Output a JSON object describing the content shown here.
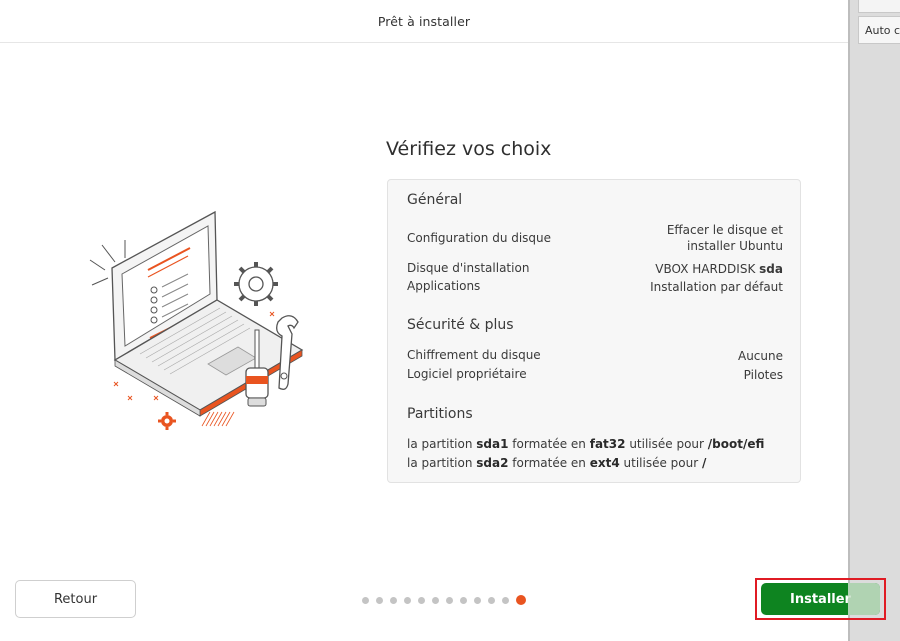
{
  "header": {
    "title": "Prêt à installer"
  },
  "side_panel": {
    "button_label": "Auto ca"
  },
  "main": {
    "heading": "Vérifiez vos choix",
    "general": {
      "title": "Général",
      "rows": [
        {
          "label": "Configuration du disque",
          "value_line1": "Effacer le disque et",
          "value_line2": "installer Ubuntu"
        },
        {
          "label": "Disque d'installation",
          "value_prefix": "VBOX HARDDISK",
          "value_bold": "sda"
        },
        {
          "label": "Applications",
          "value": "Installation par défaut"
        }
      ]
    },
    "security": {
      "title": "Sécurité & plus",
      "rows": [
        {
          "label": "Chiffrement du disque",
          "value": "Aucune"
        },
        {
          "label": "Logiciel propriétaire",
          "value": "Pilotes"
        }
      ]
    },
    "partitions": {
      "title": "Partitions",
      "items": [
        {
          "t1": "la partition",
          "name": "sda1",
          "t2": "formatée en",
          "fs": "fat32",
          "t3": "utilisée pour",
          "mount": "/boot/efi"
        },
        {
          "t1": "la partition",
          "name": "sda2",
          "t2": "formatée en",
          "fs": "ext4",
          "t3": "utilisée pour",
          "mount": "/"
        }
      ]
    }
  },
  "footer": {
    "back_label": "Retour",
    "install_label": "Installer",
    "progress": {
      "total_steps": 12,
      "current_step": 12
    }
  },
  "colors": {
    "accent": "#e95420",
    "install_green": "#0e8420",
    "highlight_red": "#e01b24"
  },
  "illustration": {
    "icons": [
      "laptop-icon",
      "gear-icon",
      "screwdriver-icon",
      "wrench-icon"
    ]
  }
}
